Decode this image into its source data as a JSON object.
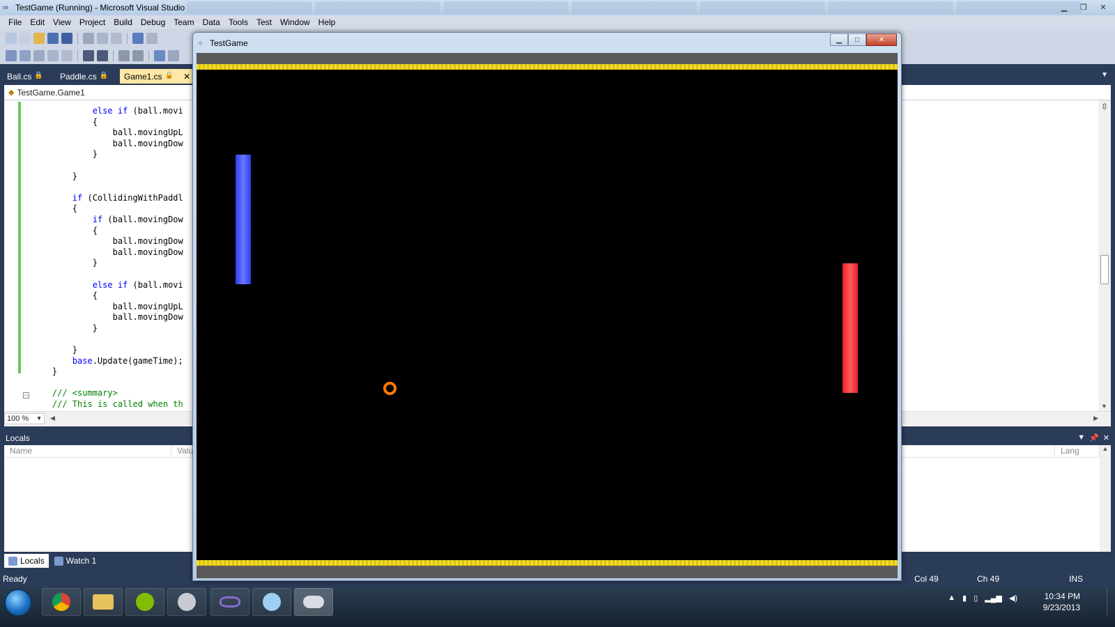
{
  "window": {
    "title": "TestGame (Running) - Microsoft Visual Studio"
  },
  "menu": [
    "File",
    "Edit",
    "View",
    "Project",
    "Build",
    "Debug",
    "Team",
    "Data",
    "Tools",
    "Test",
    "Window",
    "Help"
  ],
  "doc_tabs": [
    {
      "label": "Ball.cs",
      "active": false
    },
    {
      "label": "Paddle.cs",
      "active": false
    },
    {
      "label": "Game1.cs",
      "active": true
    }
  ],
  "editor": {
    "nav_class": "TestGame.Game1",
    "zoom": "100 %",
    "code_lines": [
      {
        "indent": "            ",
        "kw": "else if",
        "text": " (ball.movi",
        "type": "code"
      },
      {
        "indent": "            ",
        "kw": "",
        "text": "{",
        "type": "code"
      },
      {
        "indent": "                ",
        "kw": "",
        "text": "ball.movingUpL",
        "type": "code"
      },
      {
        "indent": "                ",
        "kw": "",
        "text": "ball.movingDow",
        "type": "code"
      },
      {
        "indent": "            ",
        "kw": "",
        "text": "}",
        "type": "code"
      },
      {
        "indent": "",
        "kw": "",
        "text": "",
        "type": "code"
      },
      {
        "indent": "        ",
        "kw": "",
        "text": "}",
        "type": "code"
      },
      {
        "indent": "",
        "kw": "",
        "text": "",
        "type": "code"
      },
      {
        "indent": "        ",
        "kw": "if",
        "text": " (CollidingWithPaddl",
        "type": "code"
      },
      {
        "indent": "        ",
        "kw": "",
        "text": "{",
        "type": "code"
      },
      {
        "indent": "            ",
        "kw": "if",
        "text": " (ball.movingDow",
        "type": "code"
      },
      {
        "indent": "            ",
        "kw": "",
        "text": "{",
        "type": "code"
      },
      {
        "indent": "                ",
        "kw": "",
        "text": "ball.movingDow",
        "type": "code"
      },
      {
        "indent": "                ",
        "kw": "",
        "text": "ball.movingDow",
        "type": "code"
      },
      {
        "indent": "            ",
        "kw": "",
        "text": "}",
        "type": "code"
      },
      {
        "indent": "",
        "kw": "",
        "text": "",
        "type": "code"
      },
      {
        "indent": "            ",
        "kw": "else if",
        "text": " (ball.movi",
        "type": "code"
      },
      {
        "indent": "            ",
        "kw": "",
        "text": "{",
        "type": "code"
      },
      {
        "indent": "                ",
        "kw": "",
        "text": "ball.movingUpL",
        "type": "code"
      },
      {
        "indent": "                ",
        "kw": "",
        "text": "ball.movingDow",
        "type": "code"
      },
      {
        "indent": "            ",
        "kw": "",
        "text": "}",
        "type": "code"
      },
      {
        "indent": "",
        "kw": "",
        "text": "",
        "type": "code"
      },
      {
        "indent": "        ",
        "kw": "",
        "text": "}",
        "type": "code"
      },
      {
        "indent": "        ",
        "kw": "base",
        "text": ".Update(gameTime);",
        "type": "code"
      },
      {
        "indent": "    ",
        "kw": "",
        "text": "}",
        "type": "code"
      },
      {
        "indent": "",
        "kw": "",
        "text": "",
        "type": "code"
      },
      {
        "indent": "    ",
        "kw": "",
        "text": "/// <summary>",
        "type": "comment"
      },
      {
        "indent": "    ",
        "kw": "",
        "text": "/// This is called when th",
        "type": "comment"
      }
    ]
  },
  "locals": {
    "title": "Locals",
    "columns": [
      "Name",
      "Valu",
      "Lang"
    ],
    "tabs": [
      {
        "label": "Locals",
        "active": true
      },
      {
        "label": "Watch 1",
        "active": false
      }
    ]
  },
  "status": {
    "state": "Ready",
    "col": "Col 49",
    "ch": "Ch 49",
    "mode": "INS"
  },
  "game_window": {
    "title": "TestGame",
    "wall_color": "#f3dd2a",
    "left_paddle_color": "#3a48f5",
    "right_paddle_color": "#f0303a",
    "ball_color": "#ff7a00"
  },
  "taskbar": {
    "apps": [
      "chrome-icon",
      "explorer-icon",
      "spotify-icon",
      "steam-icon",
      "visual-studio-icon",
      "skype-icon",
      "game-controller-icon"
    ],
    "time": "10:34 PM",
    "date": "9/23/2013"
  }
}
